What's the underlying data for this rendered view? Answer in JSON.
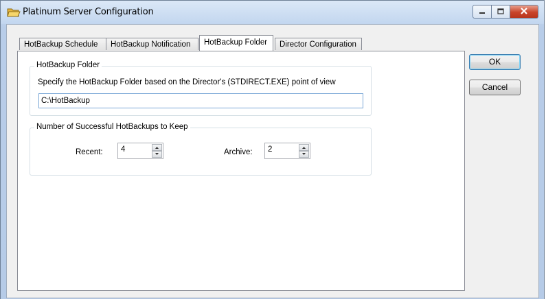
{
  "window": {
    "title": "Platinum Server Configuration",
    "icon": "folder-icon",
    "controls": [
      "minimize",
      "maximize",
      "close"
    ]
  },
  "tabs": [
    {
      "label": "HotBackup Schedule",
      "active": false
    },
    {
      "label": "HotBackup Notification",
      "active": false
    },
    {
      "label": "HotBackup Folder",
      "active": true
    },
    {
      "label": "Director Configuration",
      "active": false
    }
  ],
  "folder_group": {
    "label": "HotBackup Folder",
    "description": "Specify the HotBackup Folder based on the Director's (STDIRECT.EXE) point of view",
    "path_value": "C:\\HotBackup"
  },
  "keep_group": {
    "label": "Number of Successful HotBackups to Keep",
    "recent_label": "Recent:",
    "recent_value": "4",
    "archive_label": "Archive:",
    "archive_value": "2"
  },
  "buttons": {
    "ok_label": "OK",
    "cancel_label": "Cancel"
  },
  "colors": {
    "title_bar": "#c9daf0",
    "close_button": "#c8442a",
    "default_button_border": "#3c7fb1"
  }
}
